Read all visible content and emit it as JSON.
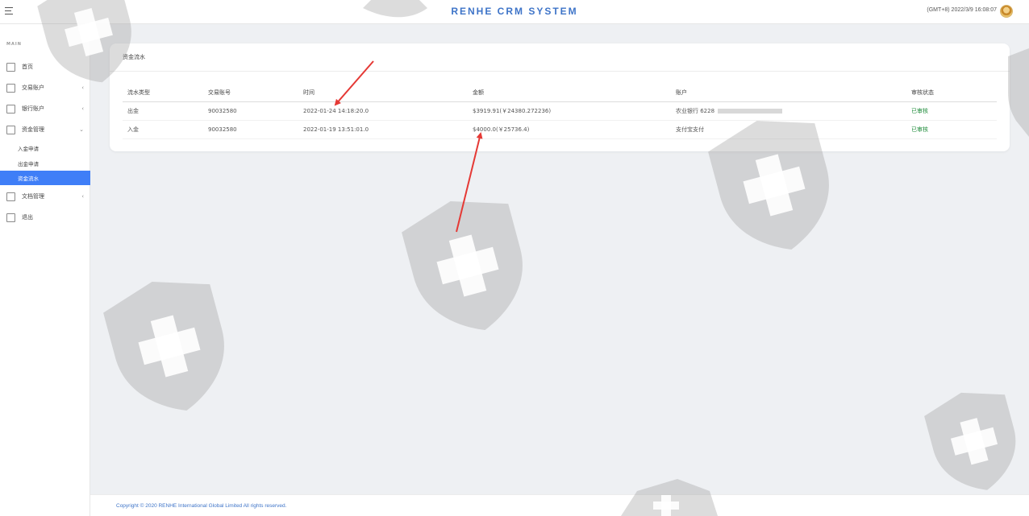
{
  "header": {
    "title": "RENHE CRM SYSTEM",
    "datetime": "(GMT+8) 2022/3/9 16:08:07"
  },
  "sidebar": {
    "section_label": "MAIN",
    "items": [
      {
        "label": "首页",
        "icon": "home-icon"
      },
      {
        "label": "交易账户",
        "icon": "document-icon"
      },
      {
        "label": "银行账户",
        "icon": "database-icon"
      },
      {
        "label": "资金管理",
        "icon": "grid-icon"
      }
    ],
    "sub_items": [
      {
        "label": "入金申请",
        "active": false
      },
      {
        "label": "出金申请",
        "active": false
      },
      {
        "label": "资金流水",
        "active": true
      }
    ],
    "bottom_items": [
      {
        "label": "文档管理",
        "icon": "file-icon"
      },
      {
        "label": "退出",
        "icon": "logout-icon"
      }
    ]
  },
  "card": {
    "title": "资金流水",
    "table": {
      "headers": [
        "流水类型",
        "交易账号",
        "时间",
        "金额",
        "账户",
        "审核状态"
      ],
      "rows": [
        [
          "出金",
          "90032580",
          "2022-01-24 14:18:20.0",
          "$3919.91(￥24380.272236)",
          "农业银行 6228",
          "已审核"
        ],
        [
          "入金",
          "90032580",
          "2022-01-19 13:51:01.0",
          "$4000.0(￥25736.4)",
          "支付宝支付",
          "已审核"
        ]
      ]
    }
  },
  "footer": {
    "copyright": "Copyright © 2020 RENHE International Global Limited All rights reserved."
  },
  "colors": {
    "brand": "#3e74c8",
    "active": "#3f7ef7",
    "status": "#1e8b3a",
    "annotation": "#e53935"
  }
}
